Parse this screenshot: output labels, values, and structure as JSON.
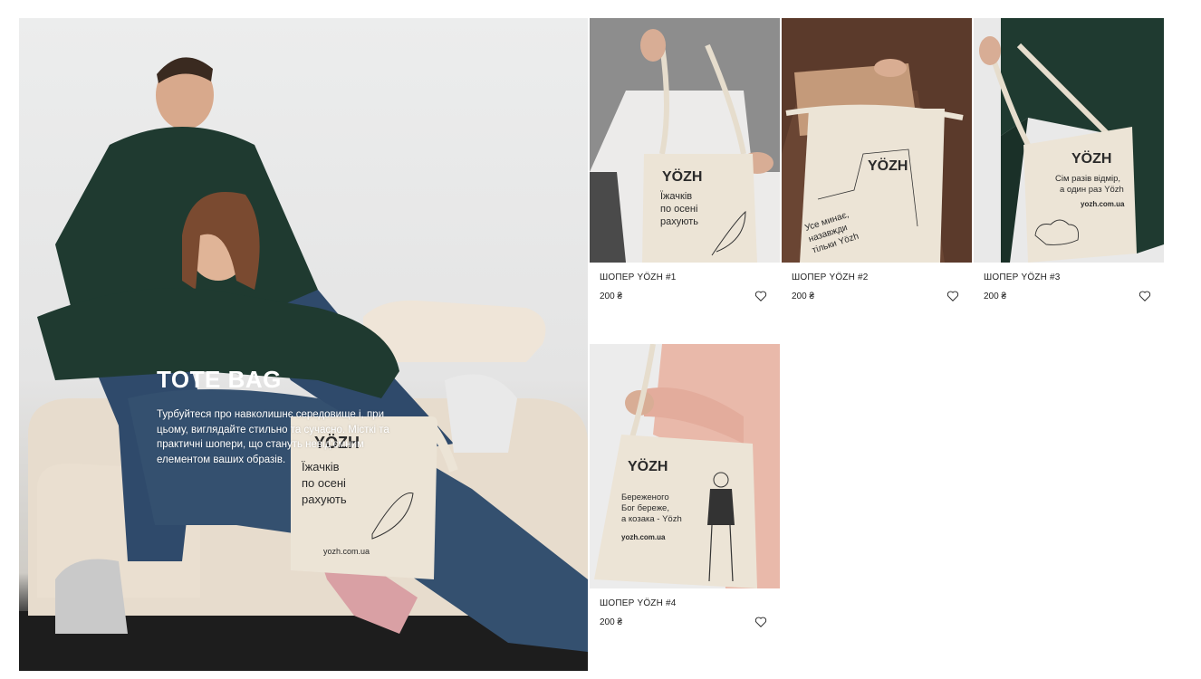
{
  "hero": {
    "title": "TOTE BAG",
    "description": "Турбуйтеся про навколишнє середовище і, при цьому, виглядайте стильно та сучасно. Місткі та практичні шопери, що стануть невід'ємним елементом ваших образів.",
    "bag_text": {
      "brand": "YÖZH",
      "line1": "Їжачків",
      "line2": "по осені",
      "line3": "рахують",
      "url": "yozh.com.ua"
    }
  },
  "products": [
    {
      "name": "ШОПЕР YÖZH #1",
      "price": "200 ₴",
      "icon": "heart-icon",
      "bag_brand": "YÖZH",
      "bag_lines": [
        "Їжачків",
        "по осені",
        "рахують"
      ]
    },
    {
      "name": "ШОПЕР YÖZH #2",
      "price": "200 ₴",
      "icon": "heart-icon",
      "bag_brand": "YÖZH",
      "bag_lines": [
        "Усе минає,",
        "назавжди",
        "тільки Yözh"
      ]
    },
    {
      "name": "ШОПЕР YÖZH #3",
      "price": "200 ₴",
      "icon": "heart-icon",
      "bag_brand": "YÖZH",
      "bag_lines": [
        "Сім разів відмір,",
        "а один раз Yözh"
      ],
      "bag_url": "yozh.com.ua"
    },
    {
      "name": "ШОПЕР YÖZH #4",
      "price": "200 ₴",
      "icon": "heart-icon",
      "bag_brand": "YÖZH",
      "bag_lines": [
        "Береженого",
        "Бог береже,",
        "а козака - Yözh"
      ],
      "bag_url": "yozh.com.ua"
    }
  ],
  "colors": {
    "tote": "#ece4d6",
    "sweater_green": "#1f3a30",
    "denim": "#2f4a6b",
    "text": "#222222"
  }
}
